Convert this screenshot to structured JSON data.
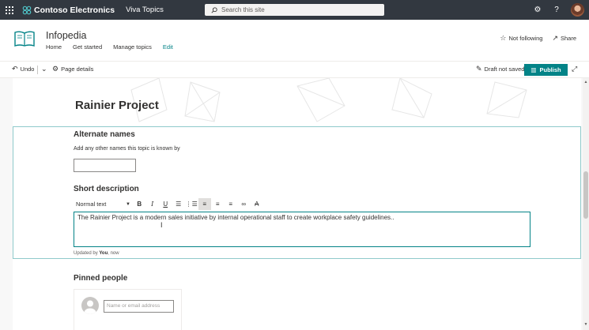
{
  "suite_bar": {
    "brand": "Contoso Electronics",
    "app": "Viva Topics",
    "search_placeholder": "Search this site",
    "icons": [
      "app-launcher-icon",
      "search-icon",
      "settings-gear-icon",
      "help-icon"
    ]
  },
  "site": {
    "title": "Infopedia",
    "nav": [
      "Home",
      "Get started",
      "Manage topics",
      "Edit"
    ],
    "follow_label": "Not following",
    "share_label": "Share"
  },
  "command_bar": {
    "undo": "Undo",
    "page_details": "Page details",
    "status": "Draft not saved",
    "publish": "Publish"
  },
  "page": {
    "title": "Rainier Project",
    "alternate_names": {
      "heading": "Alternate names",
      "hint": "Add any other names this topic is known by",
      "value": ""
    },
    "short_description": {
      "heading": "Short description",
      "format_select": "Normal text",
      "toolbar_icons": [
        "bold-icon",
        "italic-icon",
        "underline-icon",
        "bulleted-list-icon",
        "numbered-list-icon",
        "align-left-icon",
        "align-center-icon",
        "align-right-icon",
        "link-icon",
        "clear-formatting-icon"
      ],
      "text": "The Rainier Project is a modern sales initiative by internal operational staff to create workplace safety guidelines..",
      "updated_prefix": "Updated by",
      "updated_by": "You",
      "updated_time": ", now"
    },
    "pinned_people": {
      "heading": "Pinned people",
      "input_placeholder": "Name or email address"
    }
  },
  "colors": {
    "suite_bar": "#323840",
    "accent": "#038387",
    "selection_border": "#8fcacb"
  }
}
